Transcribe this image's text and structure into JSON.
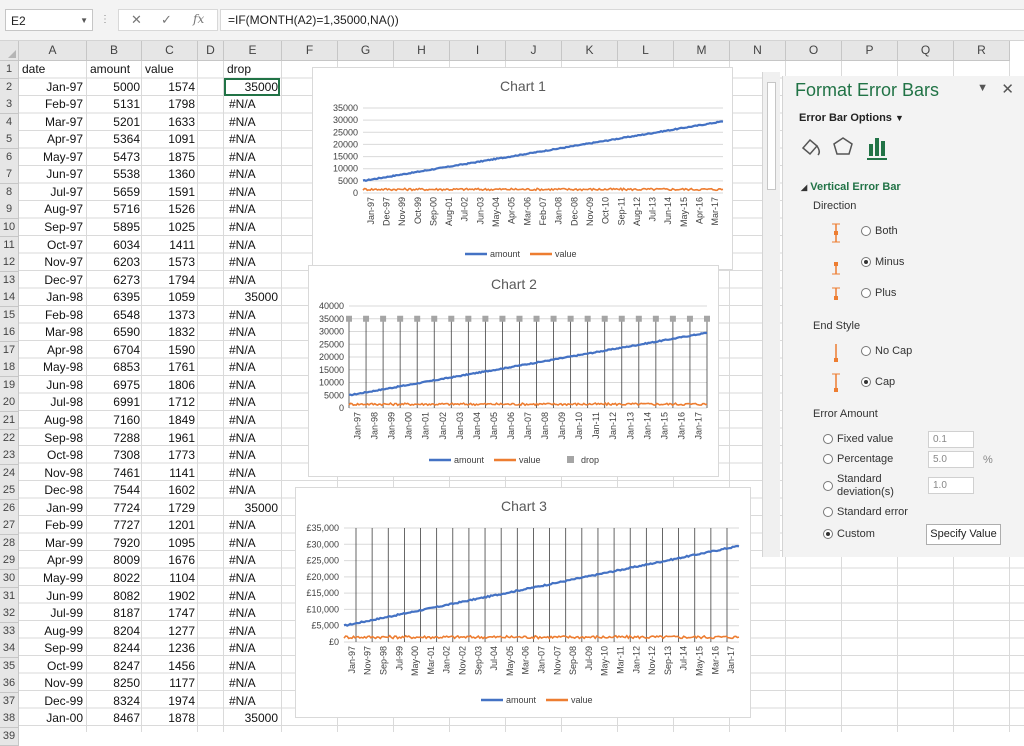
{
  "formula_bar": {
    "name_box": "E2",
    "formula": "=IF(MONTH(A2)=1,35000,NA())"
  },
  "columns": [
    "A",
    "B",
    "C",
    "D",
    "E",
    "F",
    "G",
    "H",
    "I",
    "J",
    "K",
    "L",
    "M",
    "N",
    "O",
    "P",
    "Q",
    "R"
  ],
  "headers": {
    "date": "date",
    "amount": "amount",
    "value": "value",
    "drop": "drop"
  },
  "rows": [
    [
      "Jan-97",
      "5000",
      "1574",
      "35000"
    ],
    [
      "Feb-97",
      "5131",
      "1798",
      "#N/A"
    ],
    [
      "Mar-97",
      "5201",
      "1633",
      "#N/A"
    ],
    [
      "Apr-97",
      "5364",
      "1091",
      "#N/A"
    ],
    [
      "May-97",
      "5473",
      "1875",
      "#N/A"
    ],
    [
      "Jun-97",
      "5538",
      "1360",
      "#N/A"
    ],
    [
      "Jul-97",
      "5659",
      "1591",
      "#N/A"
    ],
    [
      "Aug-97",
      "5716",
      "1526",
      "#N/A"
    ],
    [
      "Sep-97",
      "5895",
      "1025",
      "#N/A"
    ],
    [
      "Oct-97",
      "6034",
      "1411",
      "#N/A"
    ],
    [
      "Nov-97",
      "6203",
      "1573",
      "#N/A"
    ],
    [
      "Dec-97",
      "6273",
      "1794",
      "#N/A"
    ],
    [
      "Jan-98",
      "6395",
      "1059",
      "35000"
    ],
    [
      "Feb-98",
      "6548",
      "1373",
      "#N/A"
    ],
    [
      "Mar-98",
      "6590",
      "1832",
      "#N/A"
    ],
    [
      "Apr-98",
      "6704",
      "1590",
      "#N/A"
    ],
    [
      "May-98",
      "6853",
      "1761",
      "#N/A"
    ],
    [
      "Jun-98",
      "6975",
      "1806",
      "#N/A"
    ],
    [
      "Jul-98",
      "6991",
      "1712",
      "#N/A"
    ],
    [
      "Aug-98",
      "7160",
      "1849",
      "#N/A"
    ],
    [
      "Sep-98",
      "7288",
      "1961",
      "#N/A"
    ],
    [
      "Oct-98",
      "7308",
      "1773",
      "#N/A"
    ],
    [
      "Nov-98",
      "7461",
      "1141",
      "#N/A"
    ],
    [
      "Dec-98",
      "7544",
      "1602",
      "#N/A"
    ],
    [
      "Jan-99",
      "7724",
      "1729",
      "35000"
    ],
    [
      "Feb-99",
      "7727",
      "1201",
      "#N/A"
    ],
    [
      "Mar-99",
      "7920",
      "1095",
      "#N/A"
    ],
    [
      "Apr-99",
      "8009",
      "1676",
      "#N/A"
    ],
    [
      "May-99",
      "8022",
      "1104",
      "#N/A"
    ],
    [
      "Jun-99",
      "8082",
      "1902",
      "#N/A"
    ],
    [
      "Jul-99",
      "8187",
      "1747",
      "#N/A"
    ],
    [
      "Aug-99",
      "8204",
      "1277",
      "#N/A"
    ],
    [
      "Sep-99",
      "8244",
      "1236",
      "#N/A"
    ],
    [
      "Oct-99",
      "8247",
      "1456",
      "#N/A"
    ],
    [
      "Nov-99",
      "8250",
      "1177",
      "#N/A"
    ],
    [
      "Dec-99",
      "8324",
      "1974",
      "#N/A"
    ],
    [
      "Jan-00",
      "8467",
      "1878",
      "35000"
    ]
  ],
  "panel": {
    "title": "Format Error Bars",
    "options_label": "Error Bar Options",
    "section": "Vertical Error Bar",
    "direction_label": "Direction",
    "direction": [
      "Both",
      "Minus",
      "Plus"
    ],
    "end_style_label": "End Style",
    "end_style": [
      "No Cap",
      "Cap"
    ],
    "error_amount_label": "Error Amount",
    "amount_options": [
      "Fixed value",
      "Percentage",
      "Standard deviation(s)",
      "Standard error",
      "Custom"
    ],
    "fixed_value": "0.1",
    "percentage": "5.0",
    "percent_sign": "%",
    "std_dev": "1.0",
    "specify_button": "Specify Value"
  },
  "chart_data": [
    {
      "type": "line",
      "title": "Chart 1",
      "yticks": [
        "35000",
        "30000",
        "25000",
        "20000",
        "15000",
        "10000",
        "5000",
        "0"
      ],
      "ylim": [
        0,
        35000
      ],
      "xticks": [
        "Jan-97",
        "Dec-97",
        "Nov-99",
        "Oct-99",
        "Sep-00",
        "Aug-01",
        "Jul-02",
        "Jun-03",
        "May-04",
        "Apr-05",
        "Mar-06",
        "Feb-07",
        "Jan-08",
        "Dec-08",
        "Nov-09",
        "Oct-10",
        "Sep-11",
        "Aug-12",
        "Jul-13",
        "Jun-14",
        "May-15",
        "Apr-16",
        "Mar-17"
      ],
      "series": [
        {
          "name": "amount",
          "color": "#4472c4",
          "start": 5000,
          "end": 29500
        },
        {
          "name": "value",
          "color": "#ed7d31",
          "start": 1500,
          "end": 1500
        }
      ],
      "legend": "bottom"
    },
    {
      "type": "line",
      "title": "Chart 2",
      "yticks": [
        "40000",
        "35000",
        "30000",
        "25000",
        "20000",
        "15000",
        "10000",
        "5000",
        "0"
      ],
      "ylim": [
        0,
        40000
      ],
      "xticks": [
        "Jan-97",
        "Jan-98",
        "Jan-99",
        "Jan-00",
        "Jan-01",
        "Jan-02",
        "Jan-03",
        "Jan-04",
        "Jan-05",
        "Jan-06",
        "Jan-07",
        "Jan-08",
        "Jan-09",
        "Jan-10",
        "Jan-11",
        "Jan-12",
        "Jan-13",
        "Jan-14",
        "Jan-15",
        "Jan-16",
        "Jan-17"
      ],
      "series": [
        {
          "name": "amount",
          "color": "#4472c4",
          "start": 5000,
          "end": 29500
        },
        {
          "name": "value",
          "color": "#ed7d31",
          "start": 1500,
          "end": 1500
        },
        {
          "name": "drop",
          "color": "#a5a5a5",
          "value": 35000
        }
      ],
      "legend": "bottom"
    },
    {
      "type": "line",
      "title": "Chart 3",
      "yticks": [
        "£35,000",
        "£30,000",
        "£25,000",
        "£20,000",
        "£15,000",
        "£10,000",
        "£5,000",
        "£0"
      ],
      "ylim": [
        0,
        35000
      ],
      "xticks": [
        "Jan-97",
        "Nov-97",
        "Sep-98",
        "Jul-99",
        "May-00",
        "Mar-01",
        "Jan-02",
        "Nov-02",
        "Sep-03",
        "Jul-04",
        "May-05",
        "Mar-06",
        "Jan-07",
        "Nov-07",
        "Sep-08",
        "Jul-09",
        "May-10",
        "Mar-11",
        "Jan-12",
        "Nov-12",
        "Sep-13",
        "Jul-14",
        "May-15",
        "Mar-16",
        "Jan-17"
      ],
      "series": [
        {
          "name": "amount",
          "color": "#4472c4",
          "start": 5000,
          "end": 29500
        },
        {
          "name": "value",
          "color": "#ed7d31",
          "start": 1500,
          "end": 1500
        }
      ],
      "legend": "bottom"
    }
  ]
}
